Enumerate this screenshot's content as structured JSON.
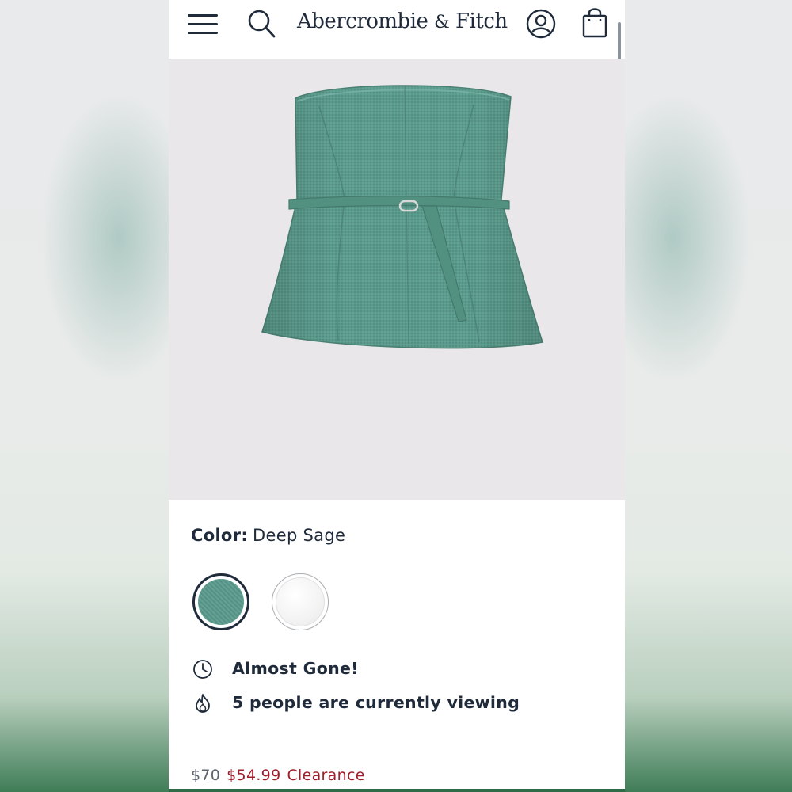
{
  "header": {
    "brand": "Abercrombie",
    "brand_amp": "&",
    "brand_tail": "Fitch",
    "icons": [
      "menu-icon",
      "search-icon",
      "account-icon",
      "shopping-bag-icon"
    ]
  },
  "product": {
    "image_alt_icon": "strapless-top-image",
    "color_label": "Color:",
    "color_value": "Deep Sage",
    "swatches": [
      {
        "name": "Deep Sage",
        "color": "#5a9a8c",
        "selected": true
      },
      {
        "name": "White",
        "color": "#f3f3f3",
        "selected": false
      }
    ],
    "stock_status": "Almost Gone!",
    "viewing_status": "5 people are currently viewing",
    "price": {
      "original": "$70",
      "sale": "$54.99",
      "badge": "Clearance"
    }
  },
  "colors": {
    "text": "#1f2a3a",
    "sale": "#a01d2b",
    "image_bg": "#e9e7ea",
    "garment": "#5a9a8c"
  }
}
